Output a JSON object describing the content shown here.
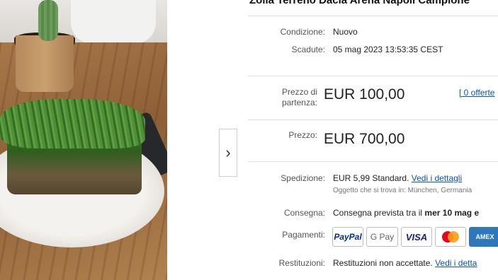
{
  "listing": {
    "title": "Zolla Terreno Dacia Arena Napoli Campione",
    "condition_label": "Condizione:",
    "condition_value": "Nuovo",
    "expired_label": "Scadute:",
    "expired_value": "05 mag 2023 13:53:35 CEST",
    "start_price_label_1": "Prezzo di",
    "start_price_label_2": "partenza:",
    "start_price_value": "EUR 100,00",
    "offers_link": "[ 0 offerte",
    "price_label": "Prezzo:",
    "price_value": "EUR 700,00"
  },
  "details": {
    "shipping_label": "Spedizione:",
    "shipping_value": "EUR 5,99 Standard.",
    "shipping_link": "Vedi i dettagli",
    "item_location": "Oggetto che si trova in: München, Germania",
    "delivery_label": "Consegna:",
    "delivery_text": "Consegna prevista tra il",
    "delivery_date": "mer 10 mag e",
    "payments_label": "Pagamenti:",
    "payment_methods": [
      "PayPal",
      "G Pay",
      "VISA",
      "Mastercard",
      "AMEX"
    ],
    "returns_label": "Restituzioni:",
    "returns_value": "Restituzioni non accettate.",
    "returns_link": "Vedi i detta"
  },
  "colors": {
    "link": "#0654ba",
    "paypal_blue": "#003087",
    "visa_blue": "#1a1f71",
    "amex_blue": "#2e77bc",
    "mc_red": "#eb001b",
    "mc_orange": "#f79e1b"
  },
  "gallery": {
    "next_label": "›"
  }
}
